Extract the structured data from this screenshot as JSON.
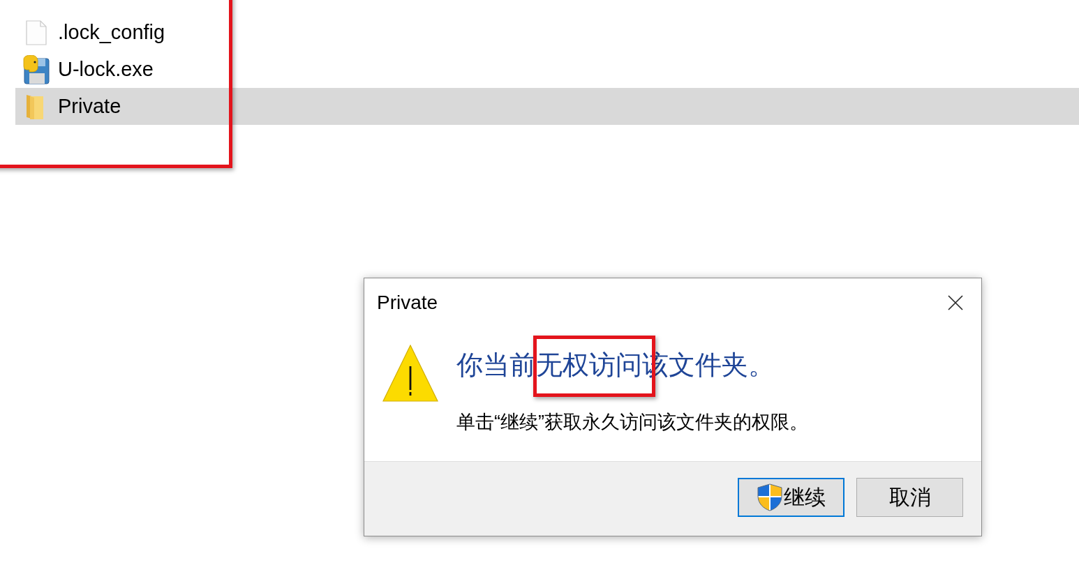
{
  "file_list": {
    "items": [
      {
        "name": ".lock_config",
        "kind": "document",
        "selected": false
      },
      {
        "name": "U-lock.exe",
        "kind": "program",
        "selected": false
      },
      {
        "name": "Private",
        "kind": "folder",
        "selected": true
      }
    ]
  },
  "dialog": {
    "title": "Private",
    "heading": "你当前无权访问该文件夹。",
    "message": "单击“继续”获取永久访问该文件夹的权限。",
    "buttons": [
      {
        "label": "继续",
        "kind": "elevated",
        "focused": true
      },
      {
        "label": "取消",
        "kind": "plain",
        "focused": false
      }
    ]
  }
}
